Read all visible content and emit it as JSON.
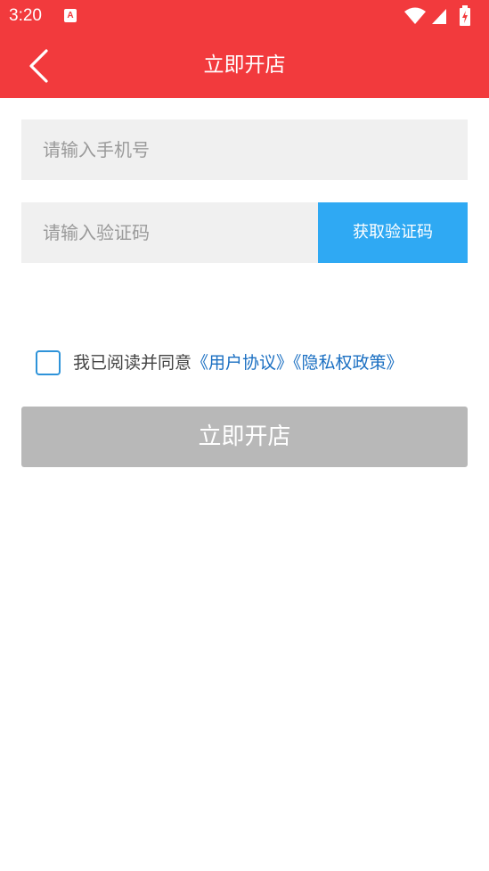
{
  "status_bar": {
    "time": "3:20",
    "app_icon_letter": "A",
    "icons": [
      "wifi-icon",
      "signal-icon",
      "battery-charging-icon"
    ]
  },
  "header": {
    "title": "立即开店",
    "back_icon": "chevron-left-icon"
  },
  "form": {
    "phone_placeholder": "请输入手机号",
    "phone_value": "",
    "code_placeholder": "请输入验证码",
    "code_value": "",
    "get_code_label": "获取验证码"
  },
  "agreement": {
    "checked": false,
    "prefix": "我已阅读并同意",
    "user_agreement_link": "《用户协议》",
    "privacy_policy_link": "《隐私权政策》"
  },
  "submit": {
    "label": "立即开店"
  },
  "colors": {
    "brand_red": "#f23a3d",
    "code_button_blue": "#2fa9f3",
    "link_blue": "#1a6fc2",
    "disabled_gray": "#b8b8b8",
    "input_bg": "#f0f0f0"
  }
}
